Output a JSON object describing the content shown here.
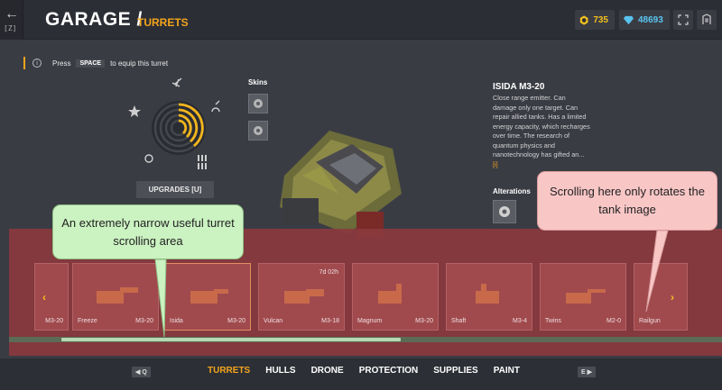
{
  "header": {
    "back_key": "[Z]",
    "title": "GARAGE /",
    "subtitle": "TURRETS",
    "crystals": "735",
    "diamonds": "48693",
    "colors": {
      "accent": "#f3a51c",
      "crystal": "#f3c21c",
      "diamond": "#59c4ef"
    }
  },
  "hint": {
    "pre": "Press",
    "key": "SPACE",
    "post": "to equip this turret"
  },
  "upgrades_label": "UPGRADES [U]",
  "skins_label": "Skins",
  "alterations_label": "Alterations",
  "turret": {
    "name": "ISIDA M3-20",
    "description": "Close range emitter. Can damage only one target. Can repair allied tanks. Has a limited energy capacity, which recharges over time. The research of quantum physics and nanotechnology has gifted an...",
    "more": "[i]"
  },
  "cards": [
    {
      "name": "",
      "level": "M3-20",
      "timer": ""
    },
    {
      "name": "Freeze",
      "level": "M3-20",
      "timer": ""
    },
    {
      "name": "Isida",
      "level": "M3-20",
      "timer": ""
    },
    {
      "name": "Vulcan",
      "level": "M3-18",
      "timer": "7d 02h"
    },
    {
      "name": "Magnum",
      "level": "M3-20",
      "timer": ""
    },
    {
      "name": "Shaft",
      "level": "M3-4",
      "timer": ""
    },
    {
      "name": "Twins",
      "level": "M2-0",
      "timer": ""
    },
    {
      "name": "Railgun",
      "level": "",
      "timer": ""
    }
  ],
  "callouts": {
    "green": "An extremely narrow useful turret scrolling area",
    "pink": "Scrolling here only rotates the tank image"
  },
  "scroll_position": 0.06,
  "bottom_nav": {
    "prev_key": "Q",
    "next_key": "E",
    "tabs": [
      "TURRETS",
      "HULLS",
      "DRONE",
      "PROTECTION",
      "SUPPLIES",
      "PAINT"
    ],
    "active": "TURRETS"
  }
}
